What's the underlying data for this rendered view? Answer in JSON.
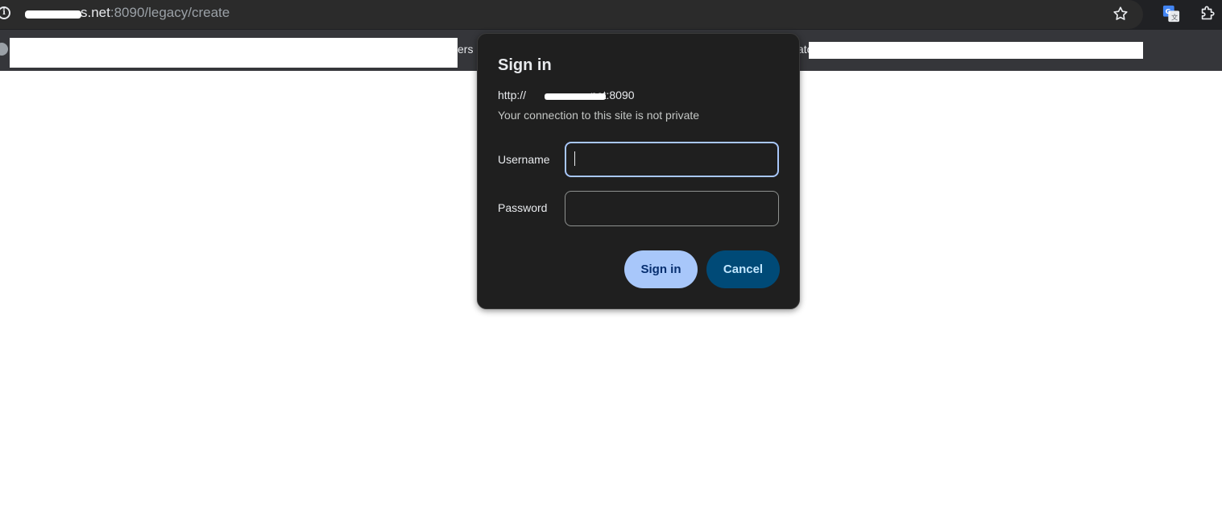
{
  "browser": {
    "url": {
      "host": "s.net",
      "path": ":8090/legacy/create"
    },
    "icons": {
      "info": "info-icon",
      "star": "star-icon",
      "translate": "translate-icon",
      "extensions": "extensions-icon"
    }
  },
  "bookmarks_bar": {
    "fragment_1": "ers c",
    "fragment_2": "ato"
  },
  "dialog": {
    "title": "Sign in",
    "origin_prefix": "http://",
    "origin_suffix": "net:8090",
    "warning": "Your connection to this site is not private",
    "username_label": "Username",
    "username_value": "",
    "password_label": "Password",
    "password_value": "",
    "signin_label": "Sign in",
    "cancel_label": "Cancel"
  },
  "colors": {
    "dialog_bg": "#1f1f1f",
    "primary_button": "#a8c7fa",
    "secondary_button": "#004a77",
    "focus_ring": "#a8c7fa"
  }
}
